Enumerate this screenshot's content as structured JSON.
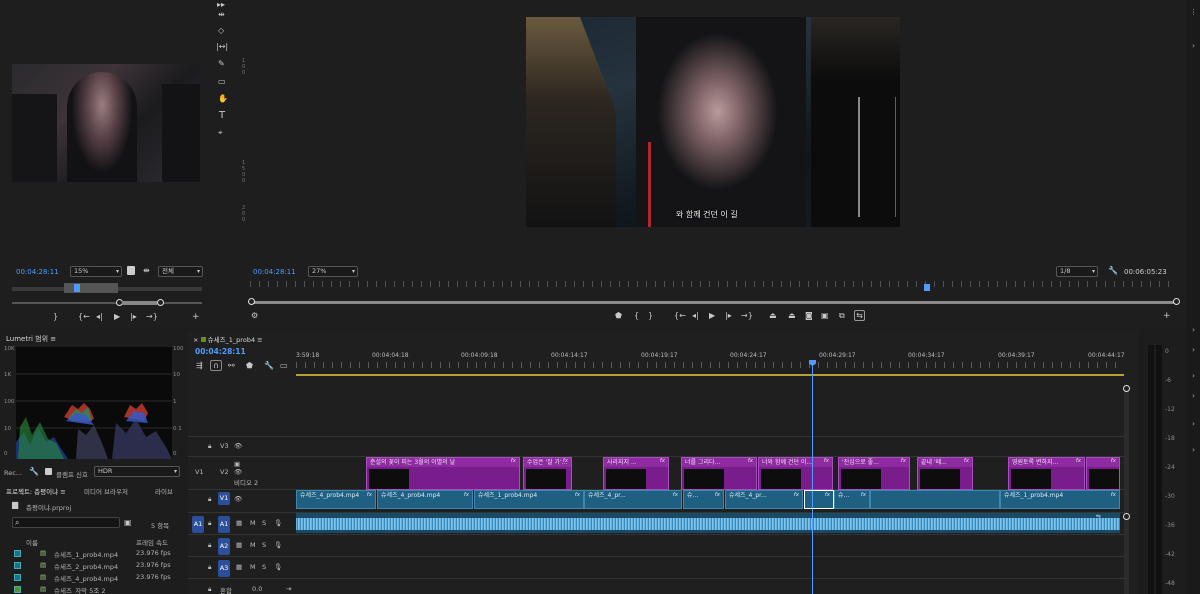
{
  "source_monitor": {
    "timecode": "00:04:28:11",
    "zoom": "15%",
    "quality": "전체"
  },
  "program_monitor": {
    "timecode": "00:04:28:11",
    "zoom": "27%",
    "quality": "1/8",
    "duration": "00:06:05:23",
    "subtitle": "와 함께 건던 이 길"
  },
  "lumetri": {
    "title": "Lumetri 범위",
    "left_scale": [
      "10K",
      "1K",
      "100",
      "10",
      "0"
    ],
    "right_scale": [
      "100",
      "10",
      "1",
      "0.1",
      "0"
    ],
    "bottom_label": "Rec...",
    "clamp_label": "클램프 신호",
    "mode": "HDR"
  },
  "project": {
    "tabs": [
      "프로젝트: 층평이냐",
      "미디어 브라우저",
      "라이브"
    ],
    "file": "층평이냐.prproj",
    "item_count": "5 항목",
    "columns": {
      "name": "이름",
      "fps": "프레임 속도"
    },
    "items": [
      {
        "name": "슈세즈_1_prob4.mp4",
        "fps": "23.976 fps",
        "color": "#1b6f8f"
      },
      {
        "name": "슈세즈_2_prob4.mp4",
        "fps": "23.976 fps",
        "color": "#1b6f8f"
      },
      {
        "name": "슈세즈_4_prob4.mp4",
        "fps": "23.976 fps",
        "color": "#1b6f8f"
      },
      {
        "name": "슈세즈_자막 5조 2",
        "fps": "",
        "color": "#5d8f2a"
      }
    ]
  },
  "timeline": {
    "tab": "슈세즈_1_prob4",
    "timecode": "00:04:28:11",
    "ruler": [
      "3:59:18",
      "00:04:04:18",
      "00:04:09:18",
      "00:04:14:17",
      "00:04:19:17",
      "00:04:24:17",
      "00:04:29:17",
      "00:04:34:17",
      "00:04:39:17",
      "00:04:44:17"
    ],
    "tracks": {
      "v3": "V3",
      "v2": "V2",
      "v2_name": "비디오 2",
      "v1_source": "V1",
      "v1": "V1",
      "a1_source": "A1",
      "a1": "A1",
      "a2": "A2",
      "a3": "A3",
      "mix": "혼합",
      "mix_value": "0.0",
      "mute": "M",
      "solo": "S"
    },
    "v2_clips": [
      {
        "label": "춘설의 꽃이 피는 3월의 이별의 날",
        "fx": "fx"
      },
      {
        "label": "수업은 '잘 가'...",
        "fx": "fx"
      },
      {
        "label": "사라지지 ...",
        "fx": "fx"
      },
      {
        "label": "너를 그리다...",
        "fx": "fx"
      },
      {
        "label": "너와 함께 건던 이...",
        "fx": "fx"
      },
      {
        "label": "'진심으로 좋...",
        "fx": "fx"
      },
      {
        "label": "끝내 '떼...",
        "fx": "fx"
      },
      {
        "label": "영원토록 변하지...",
        "fx": "fx"
      },
      {
        "label": "",
        "fx": "fx"
      }
    ],
    "v1_clips": [
      {
        "label": "슈세즈_4_prob4.mp4",
        "fx": "fx"
      },
      {
        "label": "슈세즈_4_prob4.mp4",
        "fx": "fx"
      },
      {
        "label": "슈세즈_1_prob4.mp4",
        "fx": "fx"
      },
      {
        "label": "슈세즈_4_pr...",
        "fx": "fx"
      },
      {
        "label": "슈...",
        "fx": "fx"
      },
      {
        "label": "슈세즈_4_pr...",
        "fx": "fx"
      },
      {
        "label": "",
        "fx": "fx"
      },
      {
        "label": "슈...",
        "fx": "fx"
      },
      {
        "label": "슈세즈_1_prob4.mp4",
        "fx": "fx"
      }
    ]
  },
  "vu_meter": [
    "0",
    "-6",
    "-12",
    "-18",
    "-24",
    "-30",
    "-36",
    "-42",
    "-48"
  ],
  "colors": {
    "accent_blue": "#4f9bff",
    "v2_clip": "#7a1d8c",
    "v1_clip": "#1f5f82",
    "audio_wave": "#5aa9d8"
  }
}
